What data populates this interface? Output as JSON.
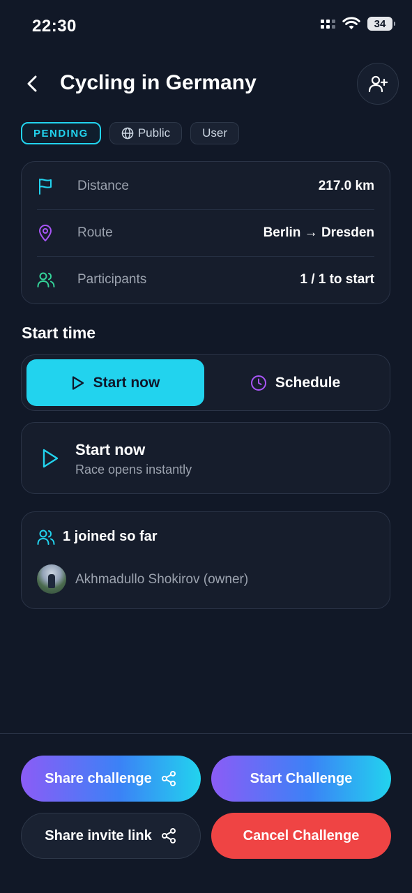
{
  "status_bar": {
    "time": "22:30",
    "battery": "34"
  },
  "header": {
    "title": "Cycling in Germany"
  },
  "tags": {
    "status": "PENDING",
    "visibility": "Public",
    "type": "User"
  },
  "info": {
    "distance": {
      "label": "Distance",
      "value": "217.0 km"
    },
    "route": {
      "label": "Route",
      "value": "Berlin → Dresden"
    },
    "participants": {
      "label": "Participants",
      "value": "1 / 1 to start"
    }
  },
  "start_time": {
    "title": "Start time",
    "options": {
      "start_now": "Start now",
      "schedule": "Schedule"
    },
    "selected": {
      "title": "Start now",
      "subtitle": "Race opens instantly"
    }
  },
  "joined": {
    "title": "1 joined so far",
    "members": [
      "Akhmadullo Shokirov (owner)"
    ]
  },
  "actions": {
    "share_challenge": "Share challenge",
    "start_challenge": "Start Challenge",
    "share_invite": "Share invite link",
    "cancel_challenge": "Cancel Challenge"
  },
  "colors": {
    "accent": "#22d3ee",
    "background": "#111827",
    "danger": "#ef4444",
    "purple": "#8b5cf6",
    "green": "#34d399"
  }
}
